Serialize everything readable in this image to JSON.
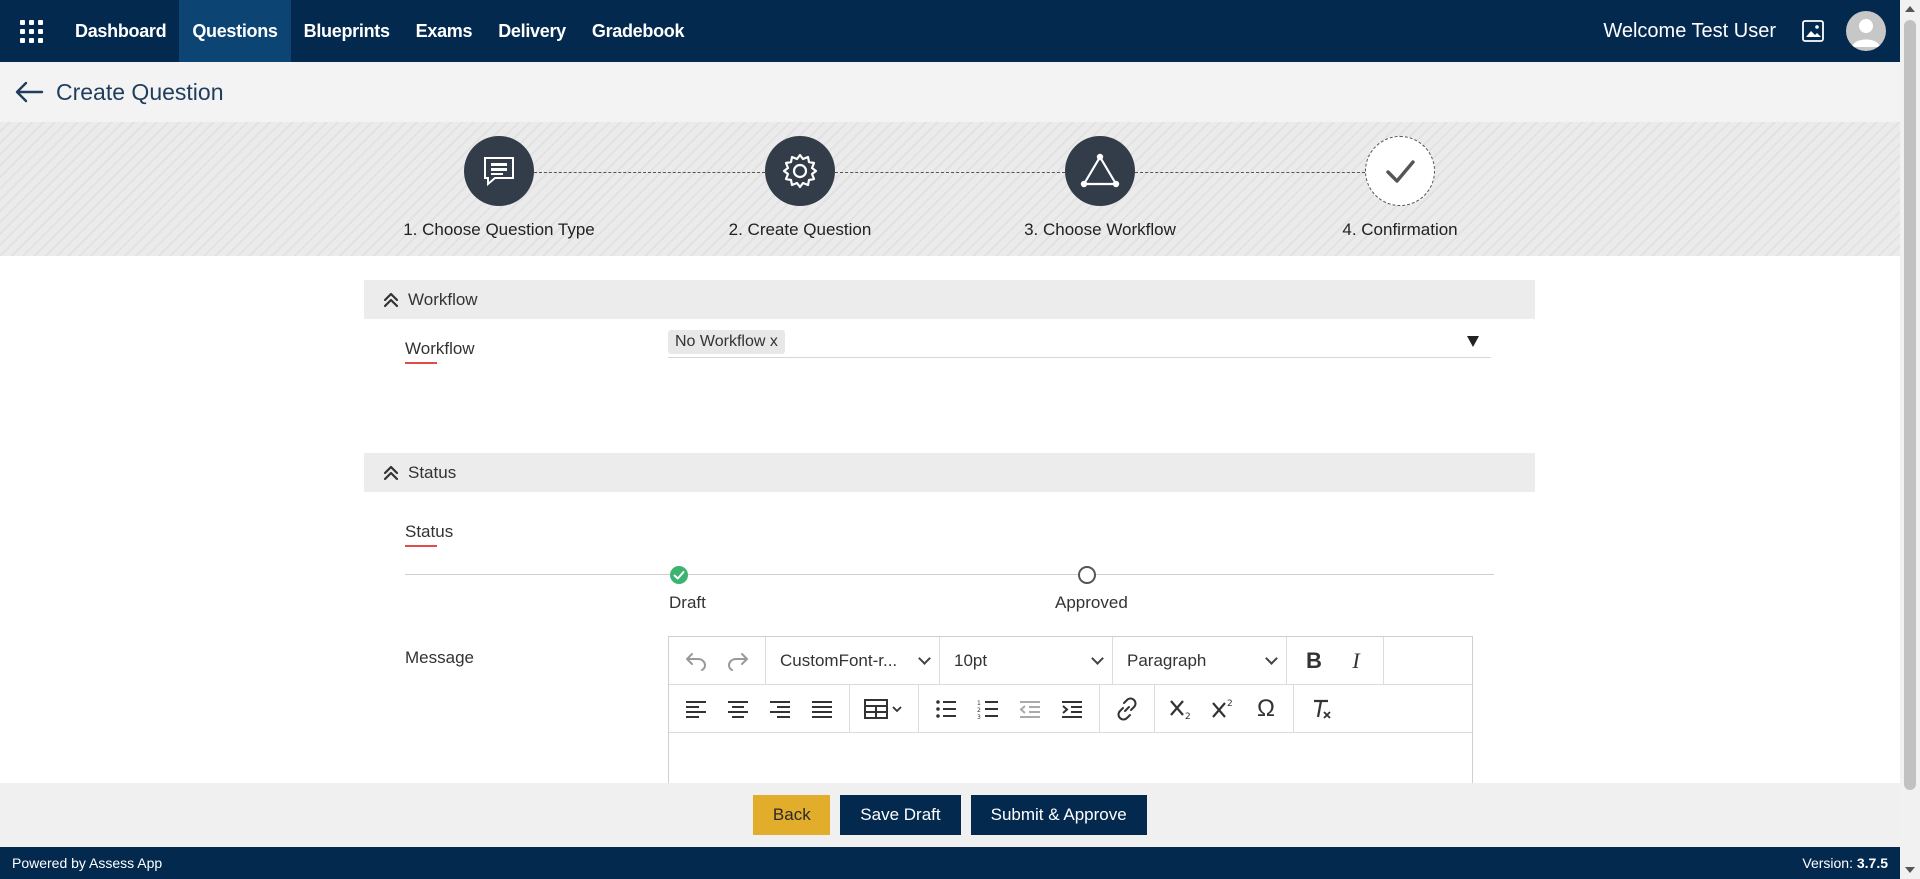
{
  "nav": {
    "items": [
      {
        "label": "Dashboard",
        "active": false
      },
      {
        "label": "Questions",
        "active": true
      },
      {
        "label": "Blueprints",
        "active": false
      },
      {
        "label": "Exams",
        "active": false
      },
      {
        "label": "Delivery",
        "active": false
      },
      {
        "label": "Gradebook",
        "active": false
      }
    ],
    "welcome": "Welcome Test User"
  },
  "header": {
    "title": "Create Question"
  },
  "stepper": {
    "steps": [
      {
        "label": "1. Choose Question Type",
        "icon": "chat-list-icon"
      },
      {
        "label": "2. Create Question",
        "icon": "gear-icon"
      },
      {
        "label": "3. Choose Workflow",
        "icon": "workflow-triangle-icon"
      },
      {
        "label": "4. Confirmation",
        "icon": "checkmark-icon"
      }
    ]
  },
  "workflow": {
    "section_title": "Workflow",
    "field_label": "Workflow",
    "chip": "No Workflow x"
  },
  "status": {
    "section_title": "Status",
    "field_label": "Status",
    "states": [
      {
        "label": "Draft",
        "done": true
      },
      {
        "label": "Approved",
        "done": false
      }
    ]
  },
  "message": {
    "field_label": "Message",
    "font": "CustomFont-r...",
    "size": "10pt",
    "block": "Paragraph"
  },
  "actions": {
    "back": "Back",
    "save": "Save Draft",
    "submit": "Submit & Approve"
  },
  "footer": {
    "powered": "Powered by Assess App",
    "version_label": "Version: ",
    "version": "3.7.5"
  },
  "colors": {
    "nav_bg": "#03294f",
    "active_nav": "#0c4474",
    "back_button": "#e2ad2a",
    "draft_check": "#3cb371"
  }
}
